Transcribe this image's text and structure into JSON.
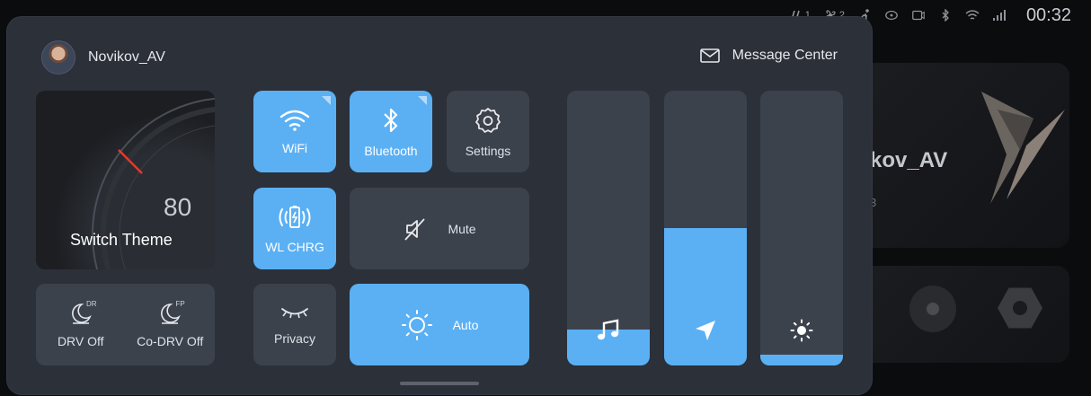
{
  "status_bar": {
    "indicators": [
      "seat-heat-1",
      "fan-2",
      "person-icon",
      "steering-icon",
      "recorder-icon",
      "bluetooth-icon",
      "wifi-icon",
      "signal-icon"
    ],
    "seat_label": "1",
    "fan_label": "2",
    "time": "00:32"
  },
  "background": {
    "user_name": "kov_AV",
    "sub_text": "3"
  },
  "header": {
    "user_name": "Novikov_AV",
    "message_center": "Message Center"
  },
  "theme": {
    "value": "80",
    "label": "Switch Theme"
  },
  "climate": {
    "driver": {
      "tag": "DR",
      "label": "DRV Off"
    },
    "codriver": {
      "tag": "FP",
      "label": "Co-DRV Off"
    }
  },
  "toggles": {
    "wifi": {
      "label": "WiFi",
      "active": true
    },
    "bluetooth": {
      "label": "Bluetooth",
      "active": true
    },
    "settings": {
      "label": "Settings",
      "active": false
    },
    "wireless_charging": {
      "label": "WL CHRG",
      "active": true
    },
    "mute": {
      "label": "Mute",
      "active": false
    },
    "privacy": {
      "label": "Privacy",
      "active": false
    },
    "auto_brightness": {
      "label": "Auto",
      "active": true
    }
  },
  "sliders": {
    "media_volume": {
      "icon": "music-note-icon",
      "level": 0.13
    },
    "navigation_volume": {
      "icon": "navigation-arrow-icon",
      "level": 0.5
    },
    "brightness": {
      "icon": "sun-icon",
      "level": 0.04
    }
  },
  "colors": {
    "accent": "#5bb0f4",
    "panel": "#2b3039",
    "tile": "#3c424c"
  }
}
